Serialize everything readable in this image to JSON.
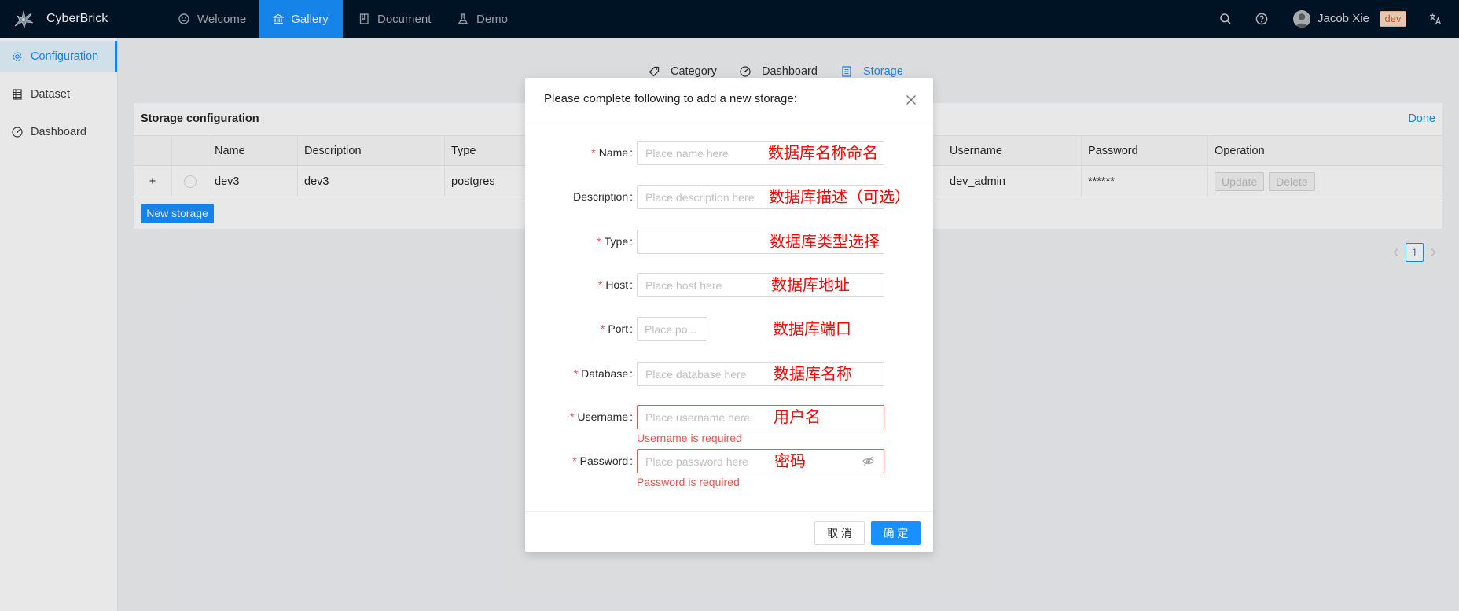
{
  "app": {
    "name": "CyberBrick",
    "logo_icon": "cyberbrick-logo-icon"
  },
  "nav": {
    "items": [
      {
        "label": "Welcome",
        "icon": "smile-icon"
      },
      {
        "label": "Gallery",
        "icon": "bank-icon",
        "active": true
      },
      {
        "label": "Document",
        "icon": "book-icon"
      },
      {
        "label": "Demo",
        "icon": "experiment-icon"
      }
    ]
  },
  "header_right": {
    "search_icon": "search-icon",
    "help_icon": "question-circle-icon",
    "user_name": "Jacob Xie",
    "env_badge": "dev",
    "language_icon": "translate-icon"
  },
  "sidebar": {
    "items": [
      {
        "label": "Configuration",
        "icon": "setting-icon",
        "active": true
      },
      {
        "label": "Dataset",
        "icon": "table-icon"
      },
      {
        "label": "Dashboard",
        "icon": "dashboard-icon"
      }
    ]
  },
  "tabs": [
    {
      "label": "Category",
      "icon": "tag-icon"
    },
    {
      "label": "Dashboard",
      "icon": "dashboard-icon"
    },
    {
      "label": "Storage",
      "icon": "container-icon",
      "active": true
    }
  ],
  "storage_card": {
    "title": "Storage configuration",
    "done_label": "Done",
    "new_storage_label": "New storage"
  },
  "table": {
    "columns": [
      "Name",
      "Description",
      "Type",
      "Username",
      "Password",
      "Operation"
    ],
    "rows": [
      {
        "expand": "+",
        "name": "dev3",
        "description": "dev3",
        "type": "postgres",
        "username": "dev_admin",
        "password": "******",
        "actions": [
          "Update",
          "Delete"
        ]
      }
    ]
  },
  "pagination": {
    "current_page": "1"
  },
  "modal": {
    "title": "Please complete following to add a new storage:",
    "required_mark": "*",
    "label_suffix": ":",
    "fields": [
      {
        "label": "Name",
        "required": true,
        "placeholder": "Place name here",
        "annotation": "数据库名称命名"
      },
      {
        "label": "Description",
        "required": false,
        "placeholder": "Place description here",
        "annotation": "数据库描述（可选）"
      },
      {
        "label": "Type",
        "required": true,
        "annotation": "数据库类型选择"
      },
      {
        "label": "Host",
        "required": true,
        "placeholder": "Place host here",
        "annotation": "数据库地址"
      },
      {
        "label": "Port",
        "required": true,
        "placeholder": "Place po...",
        "annotation": "数据库端口"
      },
      {
        "label": "Database",
        "required": true,
        "placeholder": "Place database here",
        "annotation": "数据库名称"
      },
      {
        "label": "Username",
        "required": true,
        "placeholder": "Place username here",
        "annotation": "用户名",
        "error": "Username is required"
      },
      {
        "label": "Password",
        "required": true,
        "placeholder": "Place password here",
        "annotation": "密码",
        "error": "Password is required"
      }
    ],
    "cancel_label": "取 消",
    "ok_label": "确 定"
  },
  "colors": {
    "accent": "#1890ff",
    "nav_background": "#001529",
    "error": "#ff4d4f",
    "annotation": "#ff0000",
    "env_badge_text": "#e8541c"
  }
}
